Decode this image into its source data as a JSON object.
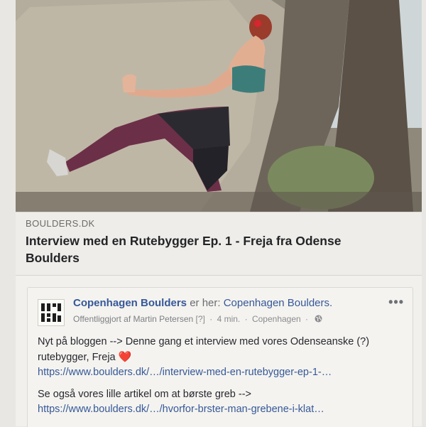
{
  "link_preview": {
    "domain": "BOULDERS.DK",
    "title": "Interview med en Rutebygger Ep. 1 - Freja fra Odense Boulders"
  },
  "post": {
    "page_name": "Copenhagen Boulders",
    "is_here_text": "er her:",
    "location": "Copenhagen Boulders.",
    "published_by": "Offentliggjort af Martin Petersen",
    "help_marker": "[?]",
    "time": "4 min.",
    "place": "Copenhagen",
    "privacy_icon": "globe-icon",
    "more_label": "•••",
    "line1": "Nyt på bloggen --> Denne gang et interview med vores Odenseanske (?) rutebygger, Freja",
    "heart_icon": "❤️",
    "url1": "https://www.boulders.dk/…/interview-med-en-rutebygger-ep-1-…",
    "line2": "Se også vores lille artikel om at børste greb -->",
    "url2": "https://www.boulders.dk/…/hvorfor-brster-man-grebene-i-klat…"
  },
  "colors": {
    "link_blue": "#365899",
    "meta_gray": "#8a8b8e",
    "heart_red": "#e0454a"
  }
}
